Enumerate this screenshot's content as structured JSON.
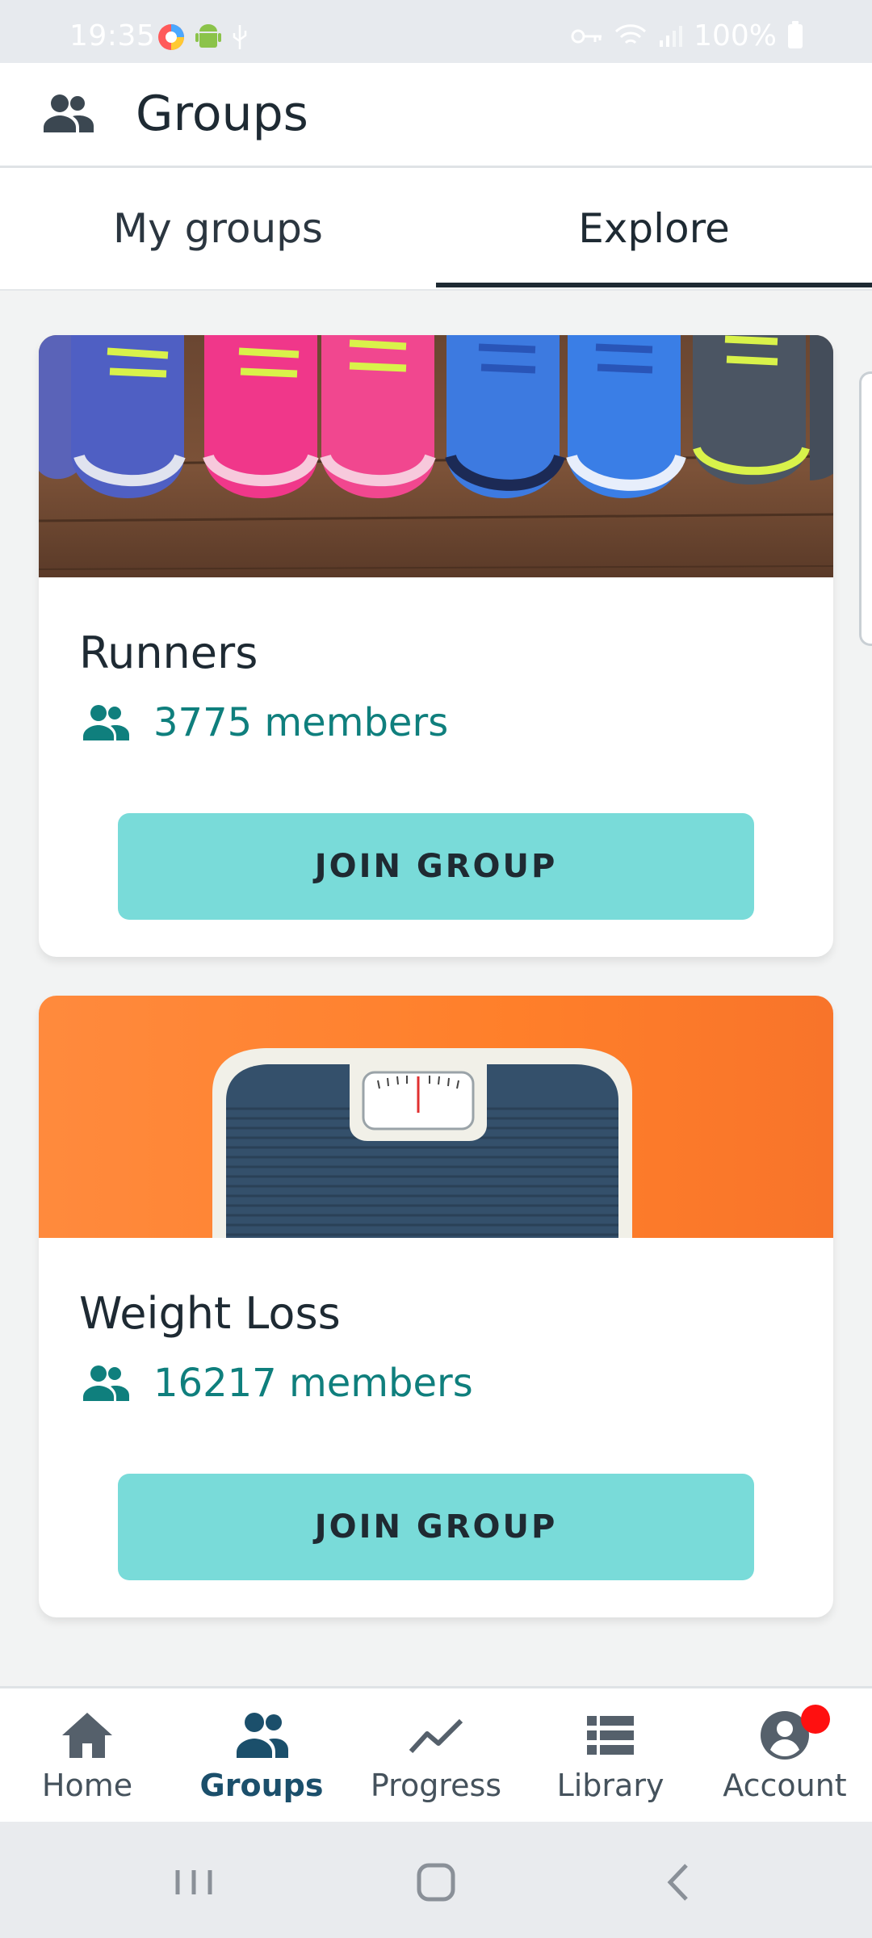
{
  "status_bar": {
    "time": "19:35",
    "battery_text": "100%"
  },
  "header": {
    "title": "Groups",
    "icon": "groups-icon"
  },
  "tabs": [
    {
      "label": "My groups",
      "active": false
    },
    {
      "label": "Explore",
      "active": true
    }
  ],
  "groups": [
    {
      "title": "Runners",
      "members": "3775 members",
      "button": "JOIN GROUP",
      "image": "sneakers-photo"
    },
    {
      "title": "Weight Loss",
      "members": "16217 members",
      "button": "JOIN GROUP",
      "image": "bathroom-scale-photo"
    }
  ],
  "bottom_nav": [
    {
      "label": "Home",
      "icon": "home-icon",
      "active": false
    },
    {
      "label": "Groups",
      "icon": "groups-icon",
      "active": true
    },
    {
      "label": "Progress",
      "icon": "trend-line-icon",
      "active": false
    },
    {
      "label": "Library",
      "icon": "list-icon",
      "active": false
    },
    {
      "label": "Account",
      "icon": "account-icon",
      "active": false,
      "notification": true
    }
  ],
  "colors": {
    "accent_teal": "#79dbd9",
    "members_text": "#0f7f7d",
    "active_nav": "#1b4f6b",
    "notification": "#ff1010"
  }
}
